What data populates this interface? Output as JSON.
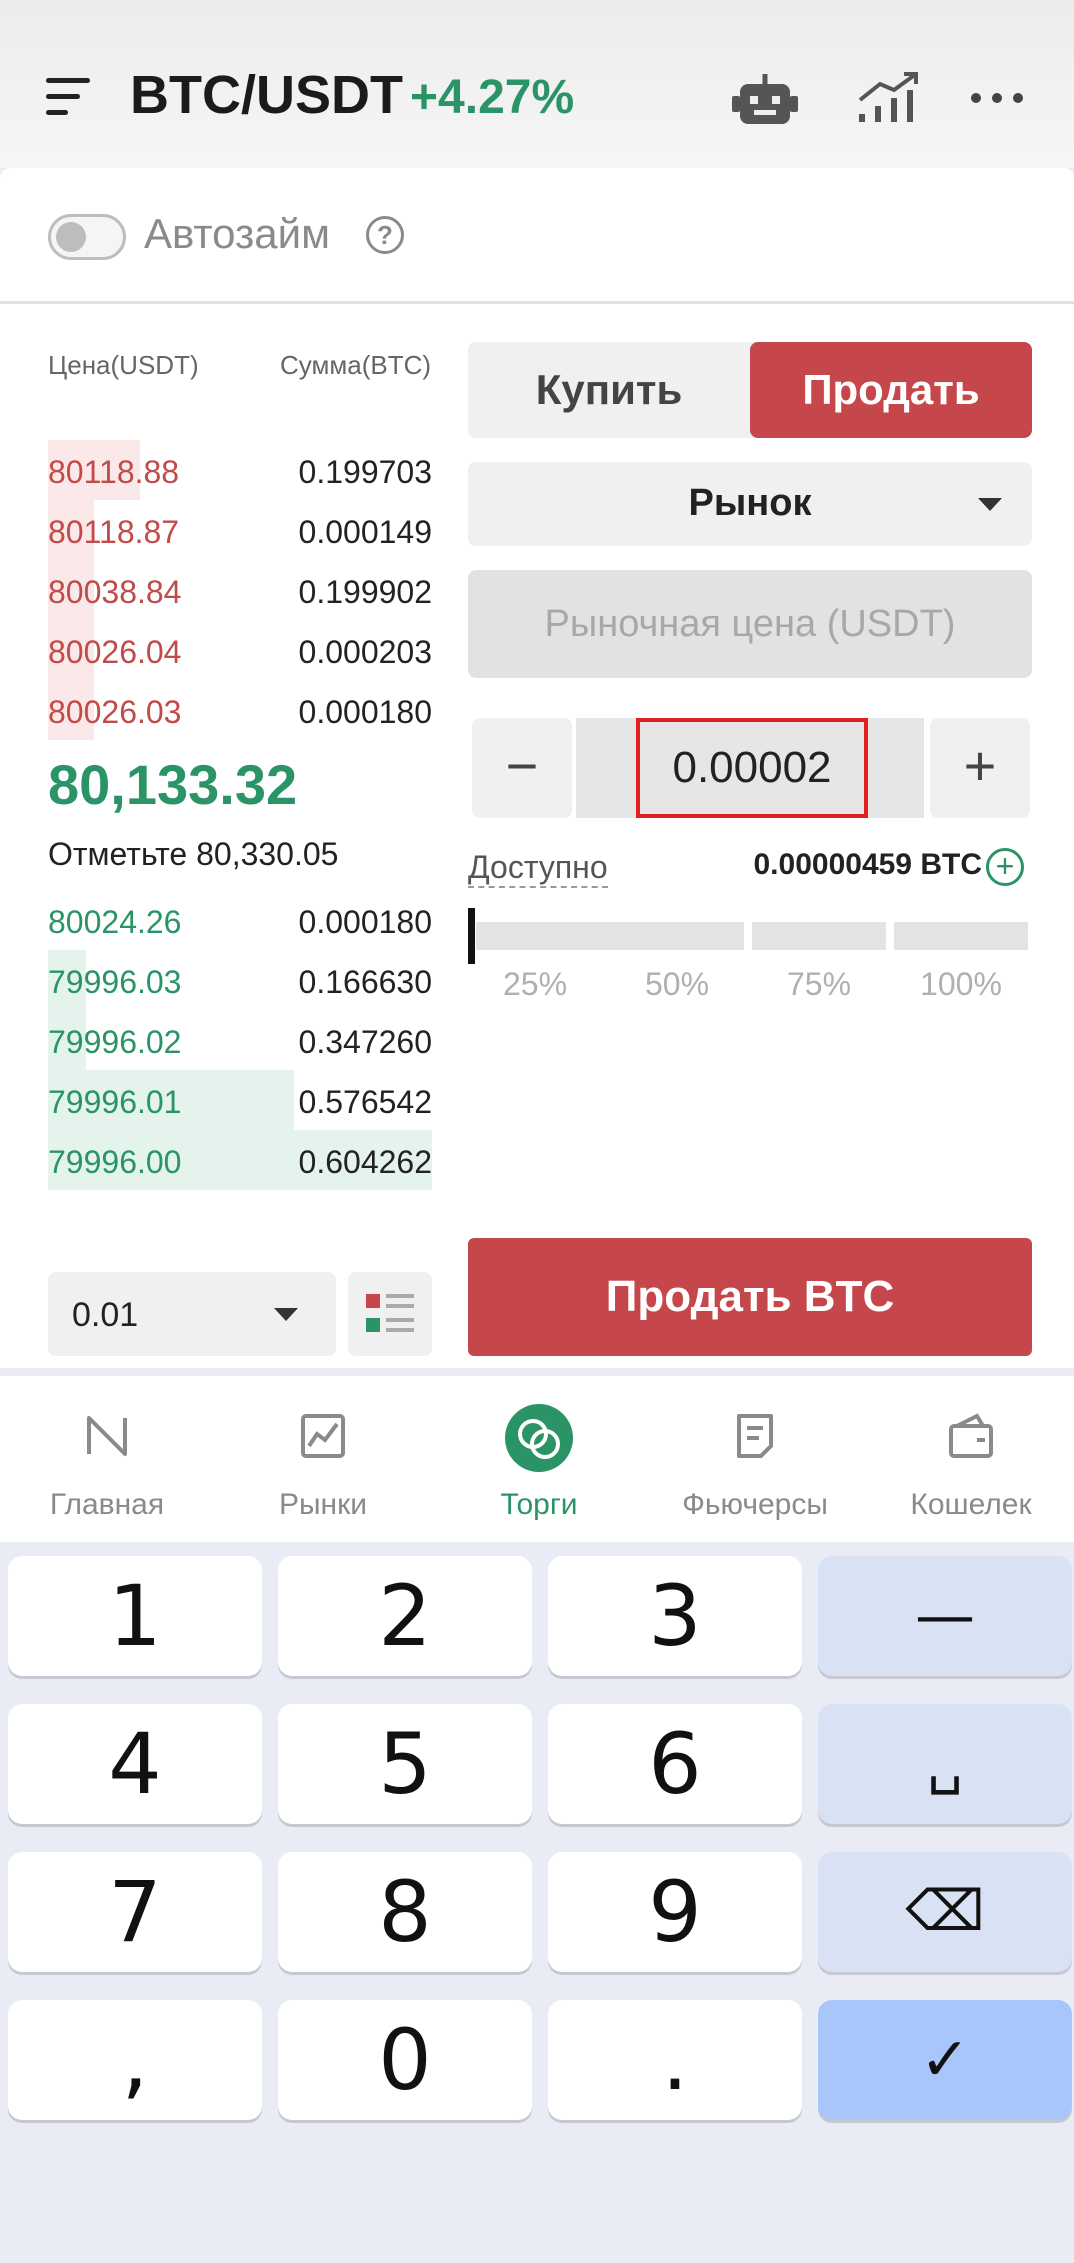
{
  "header": {
    "pair": "BTC/USDT",
    "change": "+4.27%",
    "icons": [
      "menu-icon",
      "robot-icon",
      "chart-icon",
      "more-icon"
    ],
    "accent_green": "#2a9466"
  },
  "auto_borrow": {
    "label": "Автозайм",
    "enabled": false,
    "help": "?"
  },
  "order_book": {
    "price_header": "Цена(USDT)",
    "amount_header": "Сумма(BTC)",
    "asks": [
      {
        "price": "80118.88",
        "amount": "0.199703",
        "depth": 0.24
      },
      {
        "price": "80118.87",
        "amount": "0.000149",
        "depth": 0.12
      },
      {
        "price": "80038.84",
        "amount": "0.199902",
        "depth": 0.12
      },
      {
        "price": "80026.04",
        "amount": "0.000203",
        "depth": 0.12
      },
      {
        "price": "80026.03",
        "amount": "0.000180",
        "depth": 0.12
      }
    ],
    "last_price": "80,133.32",
    "mark_price": "Отметьте 80,330.05",
    "bids": [
      {
        "price": "80024.26",
        "amount": "0.000180",
        "depth": 0.0
      },
      {
        "price": "79996.03",
        "amount": "0.166630",
        "depth": 0.1
      },
      {
        "price": "79996.02",
        "amount": "0.347260",
        "depth": 0.1
      },
      {
        "price": "79996.01",
        "amount": "0.576542",
        "depth": 0.64
      },
      {
        "price": "79996.00",
        "amount": "0.604262",
        "depth": 1.0
      }
    ],
    "precision": "0.01",
    "ask_color": "#c14a4a",
    "bid_color": "#2a9466"
  },
  "trade": {
    "buy_label": "Купить",
    "sell_label": "Продать",
    "order_type": "Рынок",
    "market_price_placeholder": "Рыночная цена (USDT)",
    "quantity": "0.00002",
    "minus": "−",
    "plus": "+",
    "available_label": "Доступно",
    "available_value": "0.00000459 BTC",
    "percent_options": [
      "25%",
      "50%",
      "75%",
      "100%"
    ],
    "slider_value": 0,
    "submit_label": "Продать BTC",
    "sell_color": "#c6474b"
  },
  "bottom_nav": [
    {
      "label": "Главная",
      "icon": "home-icon"
    },
    {
      "label": "Рынки",
      "icon": "markets-icon"
    },
    {
      "label": "Торги",
      "icon": "trade-icon",
      "active": true
    },
    {
      "label": "Фьючерсы",
      "icon": "futures-icon"
    },
    {
      "label": "Кошелек",
      "icon": "wallet-icon"
    }
  ],
  "keyboard": {
    "keys": [
      "1",
      "2",
      "3",
      "—",
      "4",
      "5",
      "6",
      "␣",
      "7",
      "8",
      "9",
      "⌫",
      ",",
      "0",
      ".",
      "✓"
    ]
  }
}
